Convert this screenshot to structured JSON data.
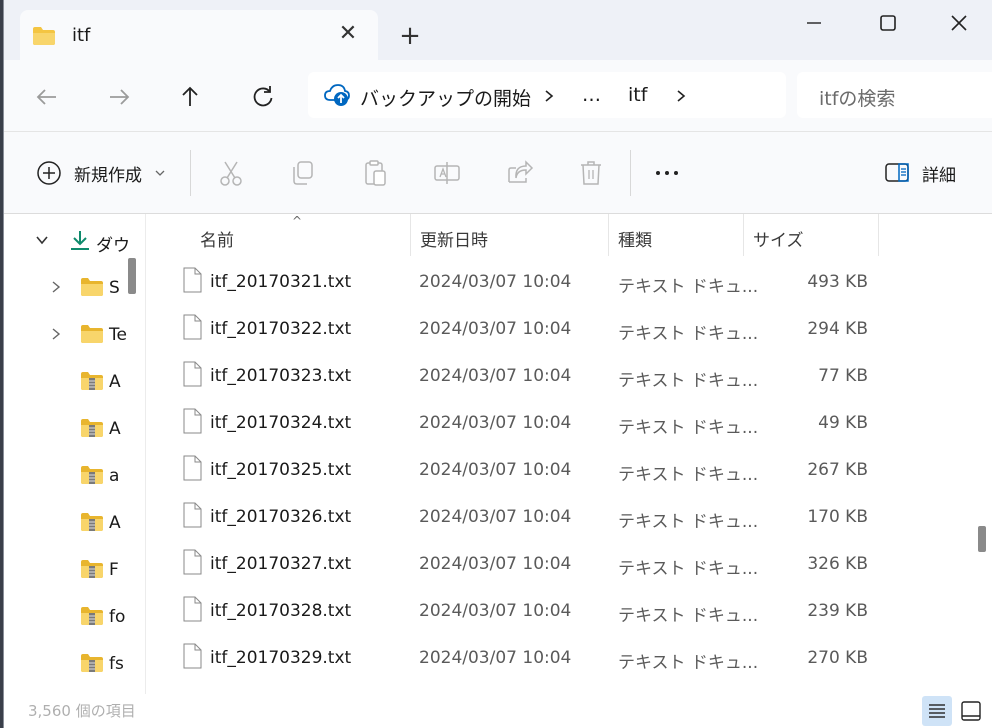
{
  "window": {
    "tab_title": "itf",
    "new_tab_symbol": "+",
    "tab_close_symbol": "✕"
  },
  "address": {
    "crumbs": [
      "バックアップの開始",
      "…",
      "itf"
    ],
    "search_placeholder": "itfの検索"
  },
  "toolbar": {
    "new_label": "新規作成",
    "details_label": "詳細"
  },
  "nav_pane": {
    "items": [
      {
        "label": "ダウ",
        "icon": "download-icon",
        "chevron": "down"
      },
      {
        "label": "S",
        "icon": "folder-icon",
        "chevron": "right"
      },
      {
        "label": "Te",
        "icon": "folder-icon",
        "chevron": "right"
      },
      {
        "label": "A",
        "icon": "zip-folder-icon",
        "chevron": ""
      },
      {
        "label": "A",
        "icon": "zip-folder-icon",
        "chevron": ""
      },
      {
        "label": "a",
        "icon": "zip-folder-icon",
        "chevron": ""
      },
      {
        "label": "A",
        "icon": "zip-folder-icon",
        "chevron": ""
      },
      {
        "label": "F",
        "icon": "zip-folder-icon",
        "chevron": ""
      },
      {
        "label": "fo",
        "icon": "zip-folder-icon",
        "chevron": ""
      },
      {
        "label": "fs",
        "icon": "zip-folder-icon",
        "chevron": ""
      }
    ]
  },
  "file_list": {
    "columns": [
      "名前",
      "更新日時",
      "種類",
      "サイズ"
    ],
    "sort_indicator": "^",
    "rows": [
      {
        "name": "itf_20170321.txt",
        "date": "2024/03/07 10:04",
        "type": "テキスト ドキュ...",
        "size": "493 KB"
      },
      {
        "name": "itf_20170322.txt",
        "date": "2024/03/07 10:04",
        "type": "テキスト ドキュ...",
        "size": "294 KB"
      },
      {
        "name": "itf_20170323.txt",
        "date": "2024/03/07 10:04",
        "type": "テキスト ドキュ...",
        "size": "77 KB"
      },
      {
        "name": "itf_20170324.txt",
        "date": "2024/03/07 10:04",
        "type": "テキスト ドキュ...",
        "size": "49 KB"
      },
      {
        "name": "itf_20170325.txt",
        "date": "2024/03/07 10:04",
        "type": "テキスト ドキュ...",
        "size": "267 KB"
      },
      {
        "name": "itf_20170326.txt",
        "date": "2024/03/07 10:04",
        "type": "テキスト ドキュ...",
        "size": "170 KB"
      },
      {
        "name": "itf_20170327.txt",
        "date": "2024/03/07 10:04",
        "type": "テキスト ドキュ...",
        "size": "326 KB"
      },
      {
        "name": "itf_20170328.txt",
        "date": "2024/03/07 10:04",
        "type": "テキスト ドキュ...",
        "size": "239 KB"
      },
      {
        "name": "itf_20170329.txt",
        "date": "2024/03/07 10:04",
        "type": "テキスト ドキュ...",
        "size": "270 KB"
      }
    ]
  },
  "status": {
    "item_count": "3,560 個の項目"
  },
  "colors": {
    "accent": "#0067c0",
    "folder": "#f4c542",
    "download_green": "#0f8a6c"
  }
}
